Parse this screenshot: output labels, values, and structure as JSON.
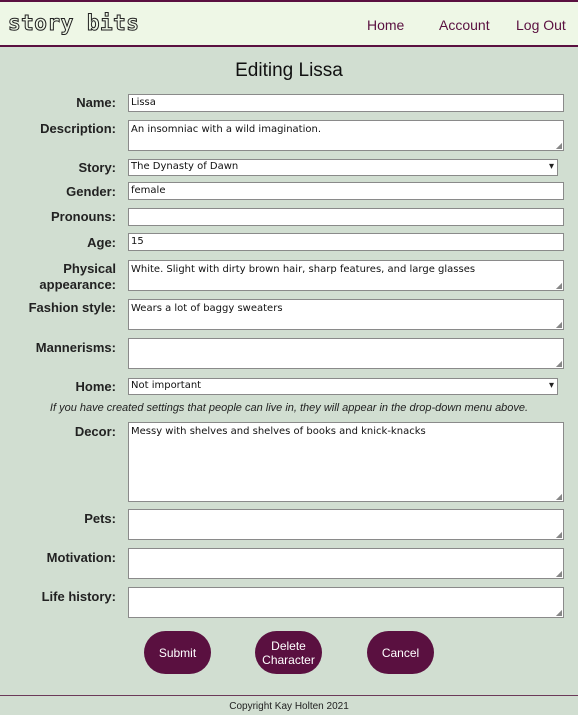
{
  "header": {
    "logo": "story bits",
    "nav": {
      "home": "Home",
      "account": "Account",
      "logout": "Log Out"
    }
  },
  "page_title": "Editing Lissa",
  "form": {
    "name": {
      "label": "Name:",
      "value": "Lissa"
    },
    "description": {
      "label": "Description:",
      "value": "An insomniac with a wild imagination."
    },
    "story": {
      "label": "Story:",
      "value": "The Dynasty of Dawn"
    },
    "gender": {
      "label": "Gender:",
      "value": "female"
    },
    "pronouns": {
      "label": "Pronouns:",
      "value": ""
    },
    "age": {
      "label": "Age:",
      "value": "15"
    },
    "physical": {
      "label_line1": "Physical",
      "label_line2": "appearance:",
      "value": "White. Slight with dirty brown hair, sharp features, and large glasses"
    },
    "fashion": {
      "label": "Fashion style:",
      "value": "Wears a lot of baggy sweaters"
    },
    "mannerisms": {
      "label": "Mannerisms:",
      "value": ""
    },
    "home": {
      "label": "Home:",
      "value": "Not important"
    },
    "home_hint": "If you have created settings that people can live in, they will appear in the drop-down menu above.",
    "decor": {
      "label": "Decor:",
      "value": "Messy with shelves and shelves of books and knick-knacks"
    },
    "pets": {
      "label": "Pets:",
      "value": ""
    },
    "motivation": {
      "label": "Motivation:",
      "value": ""
    },
    "life_history": {
      "label": "Life history:",
      "value": ""
    }
  },
  "buttons": {
    "submit": "Submit",
    "delete_line1": "Delete",
    "delete_line2": "Character",
    "cancel": "Cancel"
  },
  "footer": "Copyright Kay Holten 2021",
  "icons": {
    "select_arrow": "chevron-down-icon",
    "resize_grip": "resize-grip-icon"
  },
  "colors": {
    "accent": "#5a1040",
    "background": "#d1ded1",
    "header_bg": "#eef7e6"
  }
}
